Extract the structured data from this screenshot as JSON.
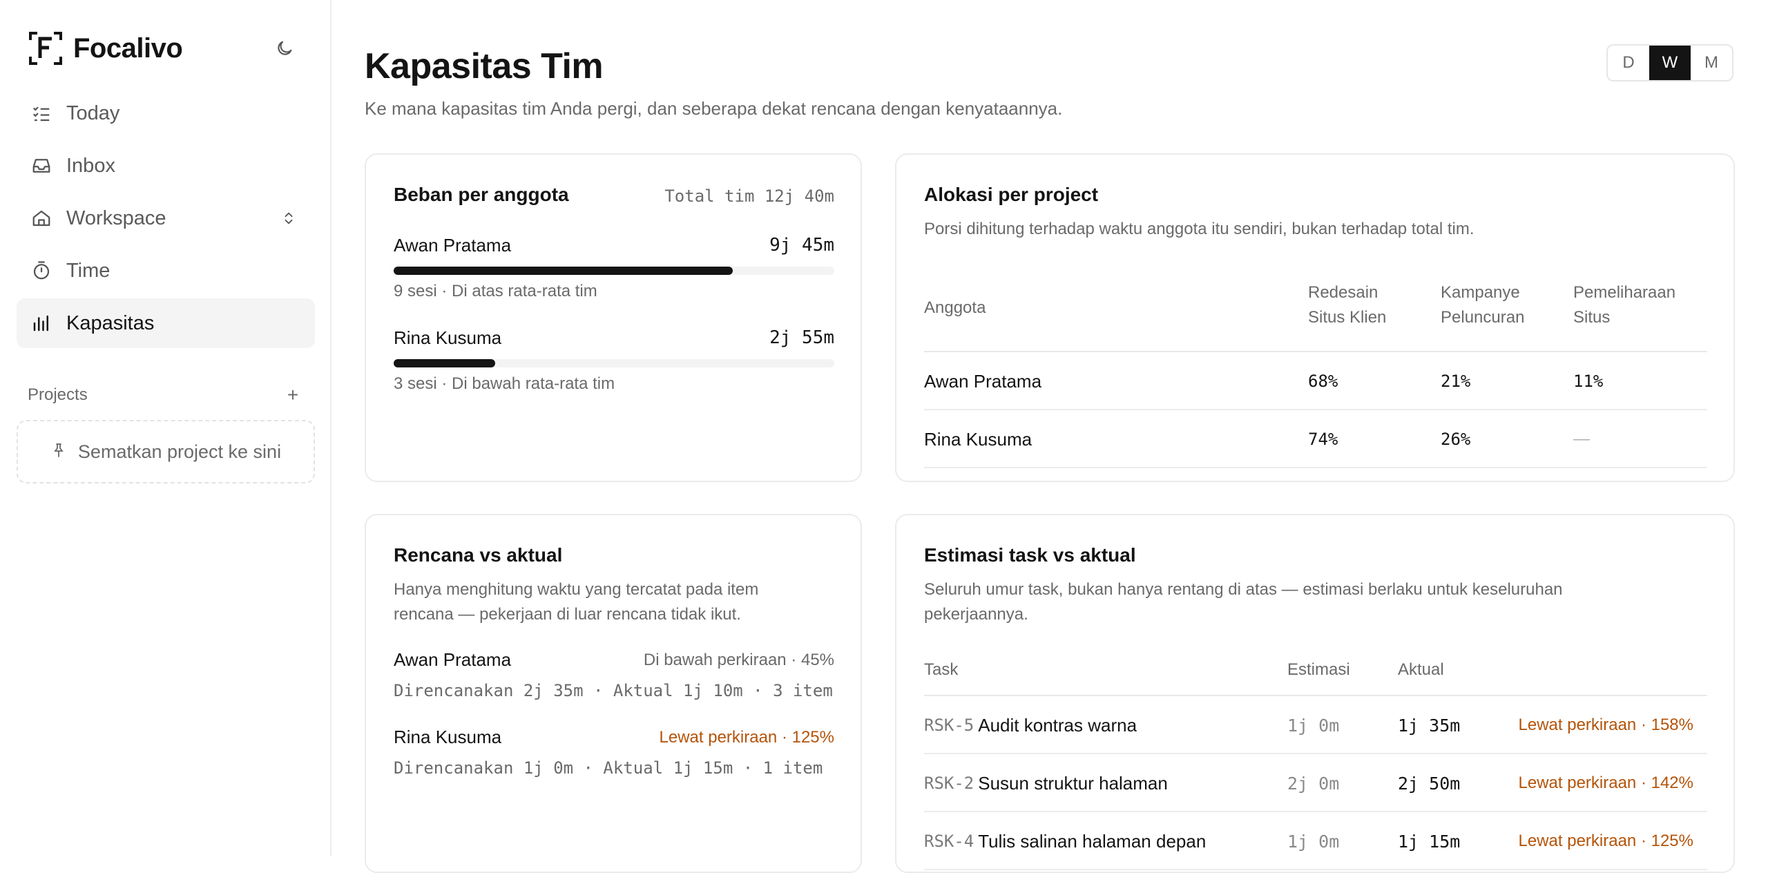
{
  "app": {
    "name": "Focalivo"
  },
  "sidebar": {
    "items": [
      {
        "label": "Today",
        "icon": "checklist-icon"
      },
      {
        "label": "Inbox",
        "icon": "inbox-icon"
      },
      {
        "label": "Workspace",
        "icon": "home-icon"
      },
      {
        "label": "Time",
        "icon": "stopwatch-icon"
      },
      {
        "label": "Kapasitas",
        "icon": "bar-chart-icon",
        "active": true
      }
    ],
    "projects_title": "Projects",
    "projects_add": "+",
    "pin_placeholder": "Sematkan project ke sini"
  },
  "header": {
    "title": "Kapasitas Tim",
    "subtitle": "Ke mana kapasitas tim Anda pergi, dan seberapa dekat rencana dengan kenyataannya.",
    "range": [
      "D",
      "W",
      "M"
    ],
    "range_selected": "W"
  },
  "load": {
    "title": "Beban per anggota",
    "total": "Total tim 12j 40m",
    "members": [
      {
        "name": "Awan Pratama",
        "time": "9j 45m",
        "note": "9 sesi · Di atas rata-rata tim",
        "share": 0.77
      },
      {
        "name": "Rina Kusuma",
        "time": "2j 55m",
        "note": "3 sesi · Di bawah rata-rata tim",
        "share": 0.23
      }
    ]
  },
  "allocation": {
    "title": "Alokasi per project",
    "desc": "Porsi dihitung terhadap waktu anggota itu sendiri, bukan terhadap total tim.",
    "col_member": "Anggota",
    "projects": [
      [
        "Redesain",
        "Situs Klien"
      ],
      [
        "Kampanye",
        "Peluncuran"
      ],
      [
        "Pemeliharaan",
        "Situs"
      ]
    ],
    "rows": [
      {
        "name": "Awan Pratama",
        "values": [
          "68%",
          "21%",
          "11%"
        ]
      },
      {
        "name": "Rina Kusuma",
        "values": [
          "74%",
          "26%",
          "—"
        ]
      }
    ]
  },
  "plan_vs_actual": {
    "title": "Rencana vs aktual",
    "desc_lines": [
      "Hanya menghitung waktu yang tercatat pada item",
      "rencana — pekerjaan di luar rencana tidak ikut."
    ],
    "members": [
      {
        "name": "Awan Pratama",
        "status": "Di bawah perkiraan · 45%",
        "over": false,
        "detail": "Direncanakan 2j 35m · Aktual 1j 10m · 3 item"
      },
      {
        "name": "Rina Kusuma",
        "status": "Lewat perkiraan · 125%",
        "over": true,
        "detail": "Direncanakan 1j 0m · Aktual 1j 15m · 1 item"
      }
    ]
  },
  "task_estimates": {
    "title": "Estimasi task vs aktual",
    "desc_lines": [
      "Seluruh umur task, bukan hanya rentang di atas — estimasi berlaku untuk keseluruhan",
      "pekerjaannya."
    ],
    "columns": [
      "Task",
      "Estimasi",
      "Aktual"
    ],
    "rows": [
      {
        "id": "RSK-5",
        "name": "Audit kontras warna",
        "estimate": "1j 0m",
        "actual": "1j 35m",
        "status": "Lewat perkiraan · 158%"
      },
      {
        "id": "RSK-2",
        "name": "Susun struktur halaman",
        "estimate": "2j 0m",
        "actual": "2j 50m",
        "status": "Lewat perkiraan · 142%"
      },
      {
        "id": "RSK-4",
        "name": "Tulis salinan halaman depan",
        "estimate": "1j 0m",
        "actual": "1j 15m",
        "status": "Lewat perkiraan · 125%"
      }
    ]
  },
  "colors": {
    "accent": "#141414",
    "over": "#b4540a",
    "muted": "#6a6a6a",
    "border": "#ebebeb"
  }
}
